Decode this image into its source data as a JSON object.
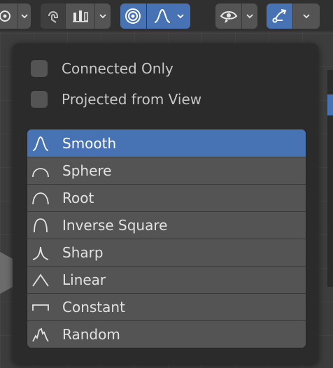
{
  "colors": {
    "accent": "#4772b3",
    "popover_bg": "#2b2b2b",
    "item_bg": "#545454",
    "header_bg": "#303030"
  },
  "header": {
    "groups": [
      {
        "icons": [
          "transform-pivot-icon",
          "chevron-down-icon"
        ]
      },
      {
        "icons": [
          "snap-magnet-icon",
          "snap-increment-icon",
          "chevron-down-icon"
        ]
      },
      {
        "icons": [
          "proportional-editing-icon",
          "falloff-smooth-icon",
          "chevron-down-icon"
        ],
        "active": [
          "proportional-editing-icon",
          "falloff-smooth-icon"
        ]
      },
      {
        "icons": [
          "visibility-eye-icon",
          "chevron-down-icon"
        ]
      },
      {
        "icons": [
          "gizmo-icon",
          "chevron-down-icon"
        ],
        "active": [
          "gizmo-icon"
        ]
      }
    ]
  },
  "popover": {
    "options": [
      {
        "label": "Connected Only",
        "checked": false
      },
      {
        "label": "Projected from View",
        "checked": false
      }
    ],
    "falloff_items": [
      {
        "label": "Smooth",
        "icon": "falloff-smooth-icon",
        "selected": true
      },
      {
        "label": "Sphere",
        "icon": "falloff-sphere-icon",
        "selected": false
      },
      {
        "label": "Root",
        "icon": "falloff-root-icon",
        "selected": false
      },
      {
        "label": "Inverse Square",
        "icon": "falloff-inverse-square-icon",
        "selected": false
      },
      {
        "label": "Sharp",
        "icon": "falloff-sharp-icon",
        "selected": false
      },
      {
        "label": "Linear",
        "icon": "falloff-linear-icon",
        "selected": false
      },
      {
        "label": "Constant",
        "icon": "falloff-constant-icon",
        "selected": false
      },
      {
        "label": "Random",
        "icon": "falloff-random-icon",
        "selected": false
      }
    ]
  }
}
